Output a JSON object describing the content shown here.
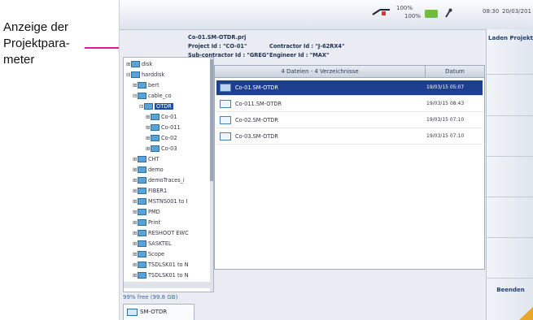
{
  "callout": {
    "text": "Anzeige der Projektpara-meter"
  },
  "status": {
    "top_pct": "100%",
    "bottom_pct": "100%",
    "time": "08:30",
    "date": "20/03/201"
  },
  "project": {
    "line1": "Co-01.SM-OTDR.prj",
    "line2a": "Project Id : \"CO-01\"",
    "line2b": "Contractor Id : \"J-62RX4\"",
    "line3a": "Sub-contractor Id : \"GREG\"",
    "line3b": "Engineer Id : \"MAX\""
  },
  "tree": [
    {
      "label": "disk",
      "indent": 0,
      "pl": "⊞"
    },
    {
      "label": "harddisk",
      "indent": 0,
      "pl": "⊟"
    },
    {
      "label": "bert",
      "indent": 1,
      "pl": "⊞"
    },
    {
      "label": "cable_co",
      "indent": 1,
      "pl": "⊟"
    },
    {
      "label": "OTDR",
      "indent": 2,
      "pl": "⊟",
      "selected": true
    },
    {
      "label": "Co-01",
      "indent": 3,
      "pl": "⊞"
    },
    {
      "label": "Co-011",
      "indent": 3,
      "pl": "⊞"
    },
    {
      "label": "Co-02",
      "indent": 3,
      "pl": "⊞"
    },
    {
      "label": "Co-03",
      "indent": 3,
      "pl": "⊞"
    },
    {
      "label": "CHT",
      "indent": 1,
      "pl": "⊞"
    },
    {
      "label": "demo",
      "indent": 1,
      "pl": "⊞"
    },
    {
      "label": "demoTraces_i",
      "indent": 1,
      "pl": "⊞"
    },
    {
      "label": "FIBER1",
      "indent": 1,
      "pl": "⊞"
    },
    {
      "label": "MSTNS001 to I",
      "indent": 1,
      "pl": "⊞"
    },
    {
      "label": "PMD",
      "indent": 1,
      "pl": "⊞"
    },
    {
      "label": "Print",
      "indent": 1,
      "pl": "⊞"
    },
    {
      "label": "RESHOOT EWC",
      "indent": 1,
      "pl": "⊞"
    },
    {
      "label": "SASKTEL",
      "indent": 1,
      "pl": "⊞"
    },
    {
      "label": "Scope",
      "indent": 1,
      "pl": "⊞"
    },
    {
      "label": "TSDLSK01 to N",
      "indent": 1,
      "pl": "⊞"
    },
    {
      "label": "TSDLSK01 to N",
      "indent": 1,
      "pl": "⊞"
    }
  ],
  "free_space": "99% free (99.8 GB)",
  "tab_label": "SM-OTDR",
  "files": {
    "header_name": "4 Dateien - 4 Verzeichnisse",
    "header_date": "Datum",
    "rows": [
      {
        "name": "Co-01.SM-OTDR",
        "date": "19/03/15 05:07",
        "selected": true
      },
      {
        "name": "Co-011.SM-OTDR",
        "date": "19/03/15 08:43"
      },
      {
        "name": "Co-02.SM-OTDR",
        "date": "19/03/15 07:10"
      },
      {
        "name": "Co-03.SM-OTDR",
        "date": "19/03/15 07:10"
      }
    ]
  },
  "panel": {
    "load": "Laden Projekt",
    "exit": "Beenden"
  }
}
